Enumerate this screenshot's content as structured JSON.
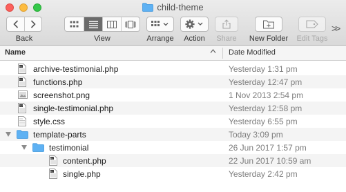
{
  "window": {
    "title": "child-theme"
  },
  "toolbar": {
    "back_label": "Back",
    "view_label": "View",
    "arrange_label": "Arrange",
    "action_label": "Action",
    "share_label": "Share",
    "new_folder_label": "New Folder",
    "edit_tags_label": "Edit Tags",
    "overflow_glyph": ">>",
    "active_view": "list"
  },
  "columns": {
    "name": "Name",
    "date_modified": "Date Modified"
  },
  "rows": [
    {
      "name": "archive-testimonial.php",
      "date": "Yesterday 1:31 pm",
      "type": "php-file",
      "level": 0
    },
    {
      "name": "functions.php",
      "date": "Yesterday 12:47 pm",
      "type": "php-file",
      "level": 0
    },
    {
      "name": "screenshot.png",
      "date": "1 Nov 2013 2:54 pm",
      "type": "image-file",
      "level": 0
    },
    {
      "name": "single-testimonial.php",
      "date": "Yesterday 12:58 pm",
      "type": "php-file",
      "level": 0
    },
    {
      "name": "style.css",
      "date": "Yesterday 6:55 pm",
      "type": "css-file",
      "level": 0
    },
    {
      "name": "template-parts",
      "date": "Today 3:09 pm",
      "type": "folder",
      "level": 0,
      "expanded": true
    },
    {
      "name": "testimonial",
      "date": "26 Jun 2017 1:57 pm",
      "type": "folder",
      "level": 1,
      "expanded": true
    },
    {
      "name": "content.php",
      "date": "22 Jun 2017 10:59 am",
      "type": "php-file",
      "level": 2
    },
    {
      "name": "single.php",
      "date": "Yesterday 2:42 pm",
      "type": "php-file",
      "level": 2
    }
  ],
  "colors": {
    "folder": "#5eb1f3",
    "close": "#fc605c",
    "minimize": "#fdbc40",
    "maximize": "#34c84a",
    "date_text": "#7e7e7e"
  }
}
